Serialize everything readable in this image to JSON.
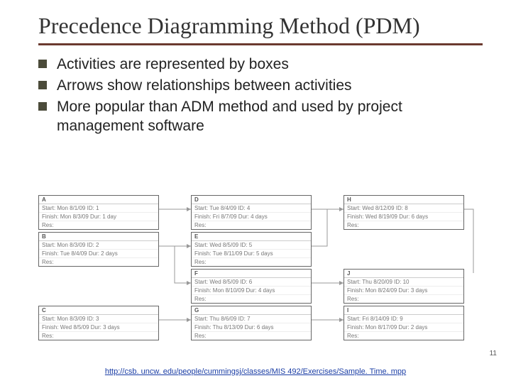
{
  "title": "Precedence Diagramming Method (PDM)",
  "bullets": [
    "Activities are represented by boxes",
    "Arrows show relationships between activities",
    "More popular than ADM method and used by project management software"
  ],
  "nodes": {
    "A": {
      "label": "A",
      "start": "Start: Mon 8/1/09 ID: 1",
      "finish": "Finish: Mon 8/3/09 Dur: 1 day",
      "res": "Res:"
    },
    "B": {
      "label": "B",
      "start": "Start: Mon 8/3/09 ID: 2",
      "finish": "Finish: Tue 8/4/09 Dur: 2 days",
      "res": "Res:"
    },
    "C": {
      "label": "C",
      "start": "Start: Mon 8/3/09 ID: 3",
      "finish": "Finish: Wed 8/5/09 Dur: 3 days",
      "res": "Res:"
    },
    "D": {
      "label": "D",
      "start": "Start: Tue 8/4/09 ID: 4",
      "finish": "Finish: Fri 8/7/09 Dur: 4 days",
      "res": "Res:"
    },
    "E": {
      "label": "E",
      "start": "Start: Wed 8/5/09 ID: 5",
      "finish": "Finish: Tue 8/11/09 Dur: 5 days",
      "res": "Res:"
    },
    "F": {
      "label": "F",
      "start": "Start: Wed 8/5/09 ID: 6",
      "finish": "Finish: Mon 8/10/09 Dur: 4 days",
      "res": "Res:"
    },
    "G": {
      "label": "G",
      "start": "Start: Thu 8/6/09 ID: 7",
      "finish": "Finish: Thu 8/13/09 Dur: 6 days",
      "res": "Res:"
    },
    "H": {
      "label": "H",
      "start": "Start: Wed 8/12/09 ID: 8",
      "finish": "Finish: Wed 8/19/09 Dur: 6 days",
      "res": "Res:"
    },
    "I": {
      "label": "I",
      "start": "Start: Fri 8/14/09 ID: 9",
      "finish": "Finish: Mon 8/17/09 Dur: 2 days",
      "res": "Res:"
    },
    "J": {
      "label": "J",
      "start": "Start: Thu 8/20/09 ID: 10",
      "finish": "Finish: Mon 8/24/09 Dur: 3 days",
      "res": "Res:"
    }
  },
  "page_number": "11",
  "footer_url": "http://csb.uncw.edu/people/cummingsj/classes/MIS492/Exercises/SampleTime.mpp",
  "footer_display": "http://csb. uncw. edu/people/cummingsj/classes/MIS 492/Exercises/Sample. Time. mpp"
}
